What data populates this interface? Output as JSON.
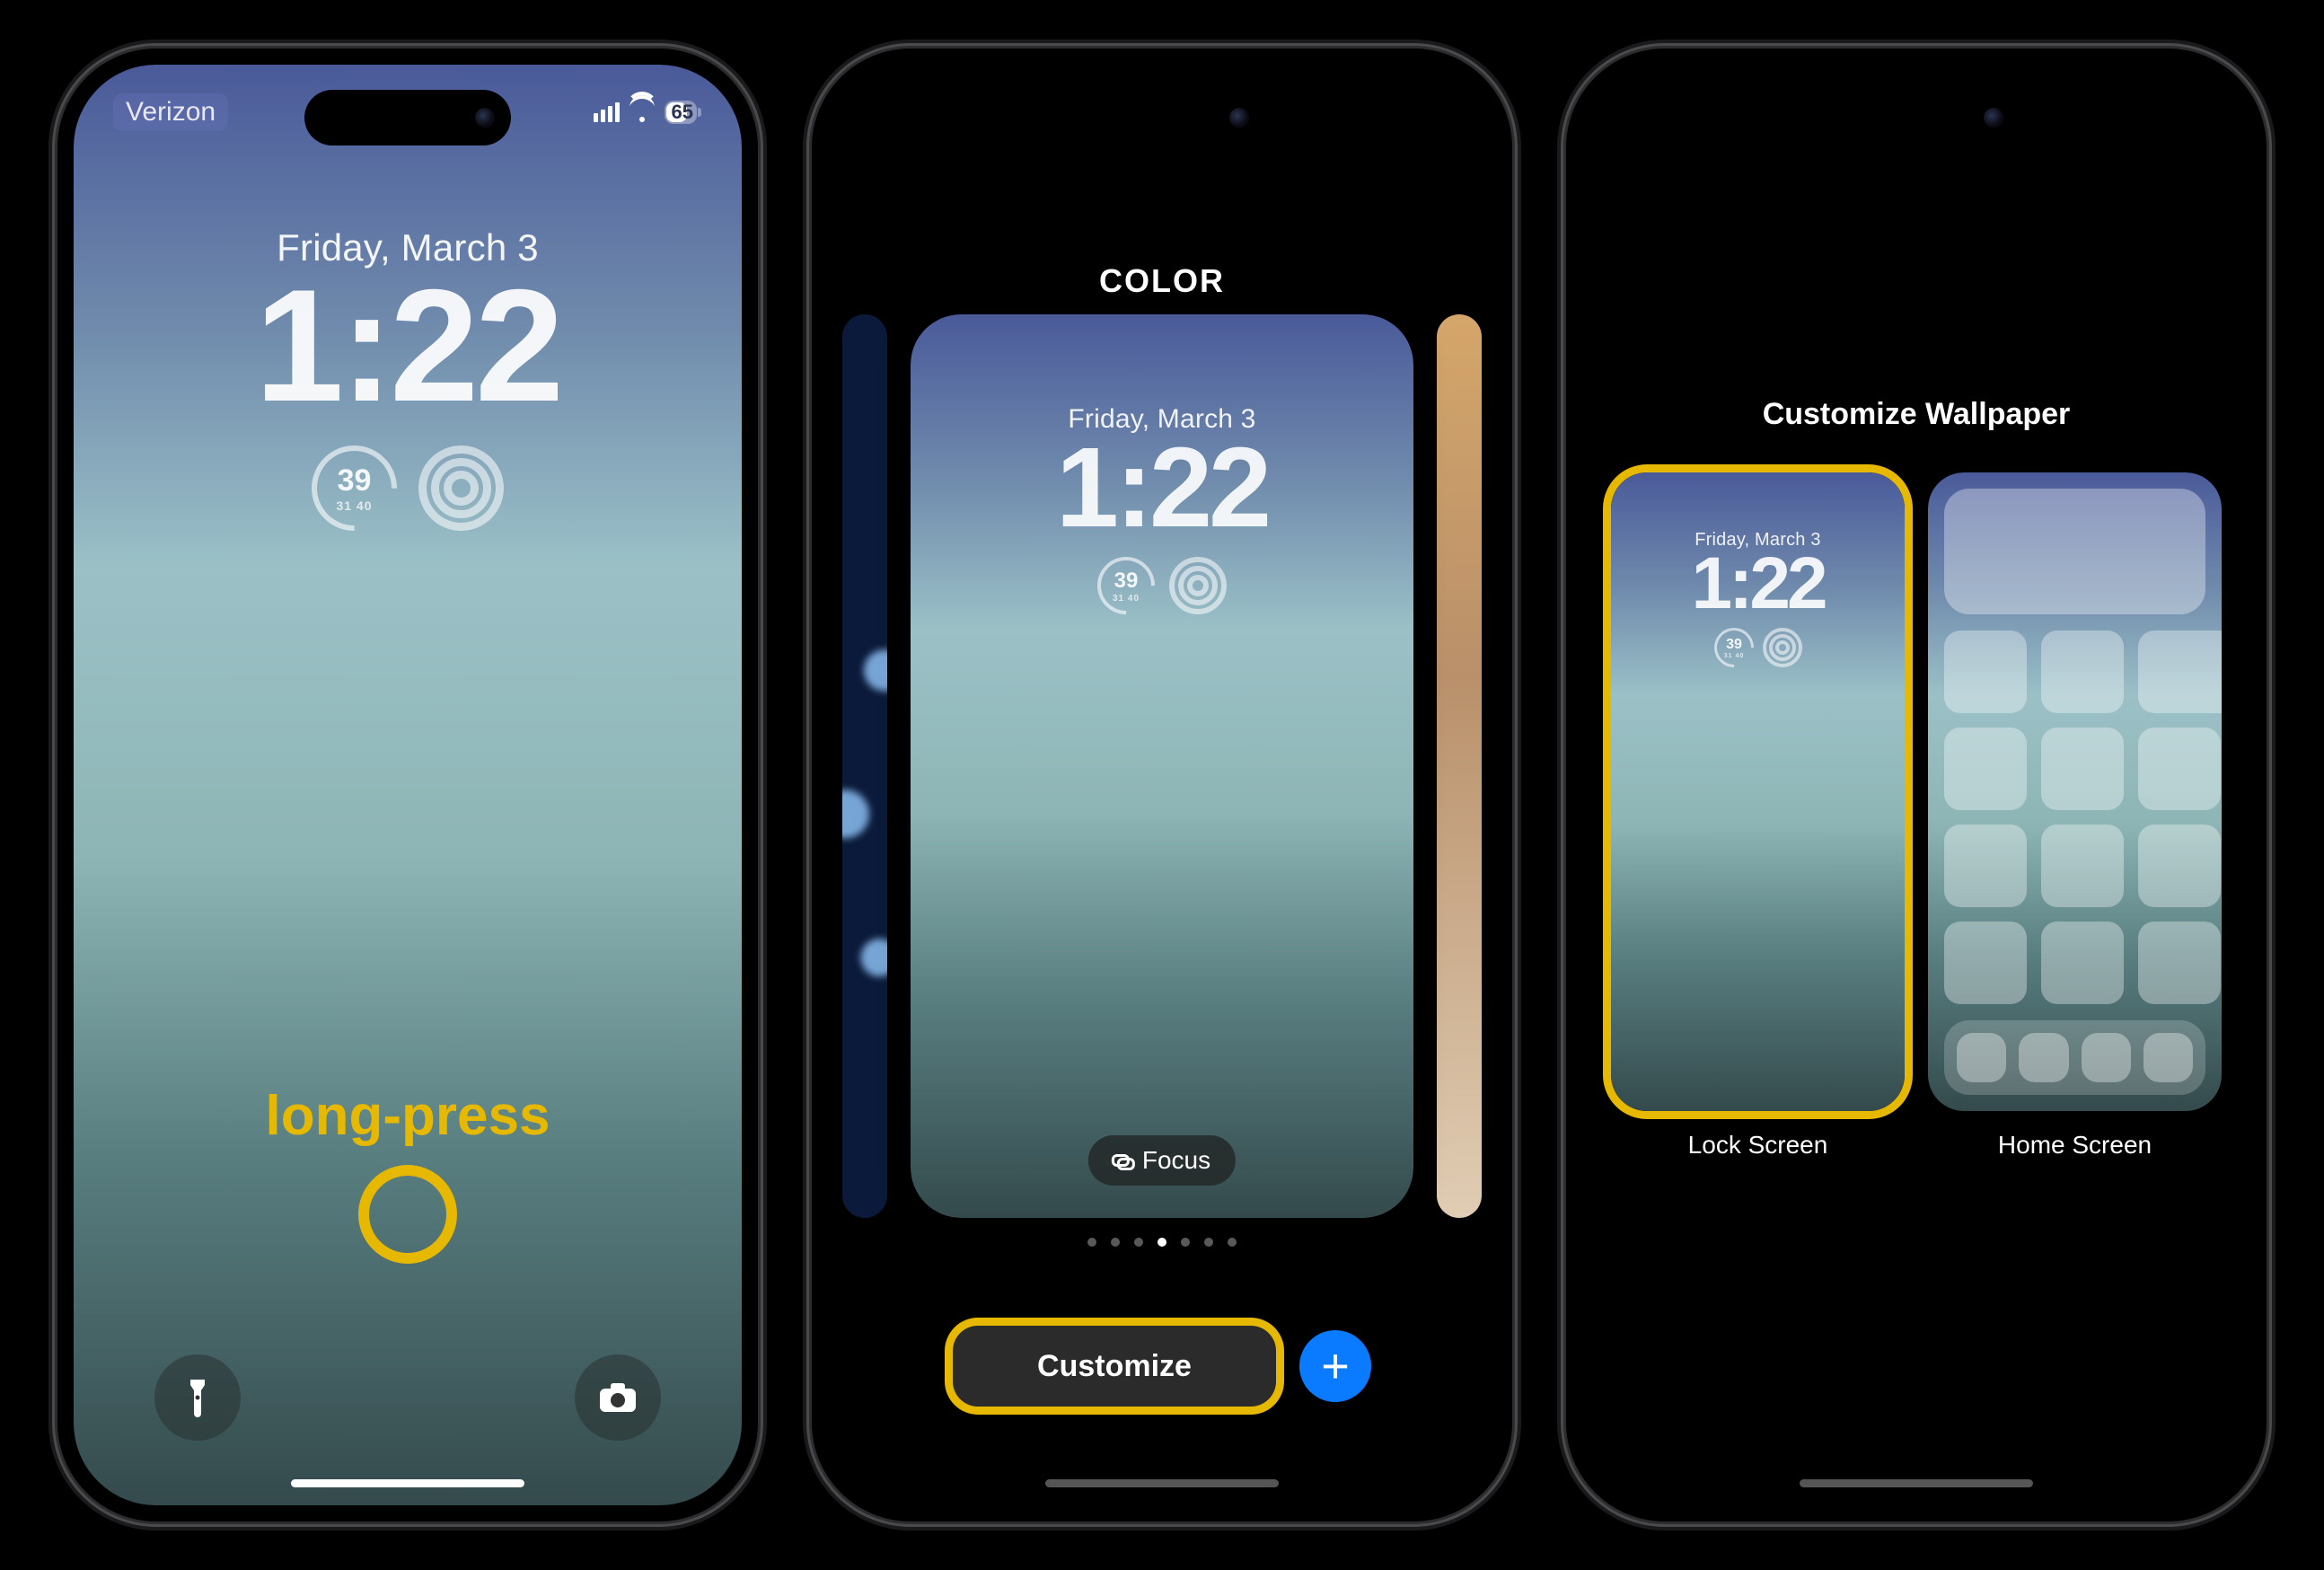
{
  "phone1": {
    "status": {
      "carrier": "Verizon",
      "battery_pct": "65"
    },
    "lockscreen": {
      "date": "Friday, March 3",
      "time": "1:22",
      "aqi_value": "39",
      "aqi_sub": "31  40"
    },
    "annotation": {
      "label": "long-press"
    }
  },
  "phone2": {
    "header": "COLOR",
    "lockscreen": {
      "date": "Friday, March 3",
      "time": "1:22",
      "aqi_value": "39",
      "aqi_sub": "31  40"
    },
    "focus_label": "Focus",
    "customize_label": "Customize",
    "page_dots": {
      "count": 7,
      "active_index": 3
    }
  },
  "phone3": {
    "title": "Customize Wallpaper",
    "lockscreen": {
      "date": "Friday, March 3",
      "time": "1:22",
      "aqi_value": "39",
      "aqi_sub": "31  40"
    },
    "tiles": {
      "lock_label": "Lock Screen",
      "home_label": "Home Screen"
    }
  },
  "colors": {
    "annotation": "#e6b800",
    "accent_blue": "#0a7aff"
  }
}
